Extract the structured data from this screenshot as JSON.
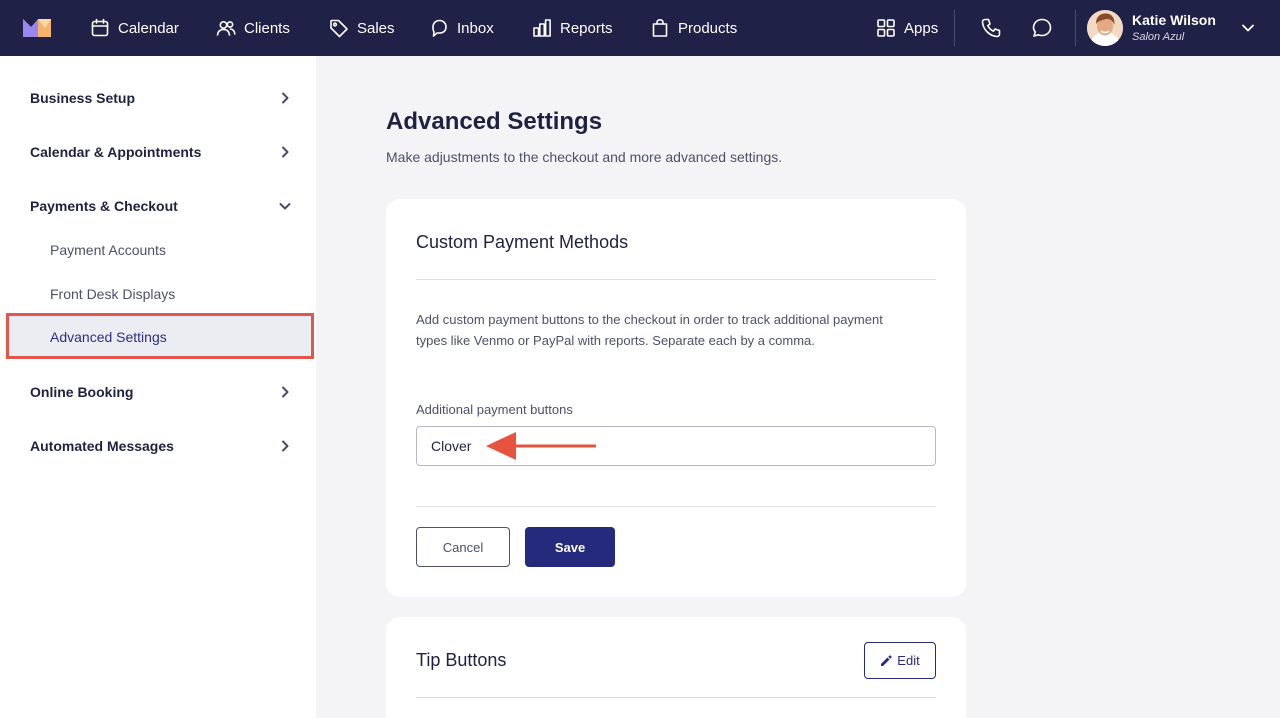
{
  "nav": {
    "items": [
      {
        "label": "Calendar",
        "icon": "calendar-icon"
      },
      {
        "label": "Clients",
        "icon": "users-icon"
      },
      {
        "label": "Sales",
        "icon": "tag-icon"
      },
      {
        "label": "Inbox",
        "icon": "inbox-icon"
      },
      {
        "label": "Reports",
        "icon": "bar-chart-icon"
      },
      {
        "label": "Products",
        "icon": "shopping-bag-icon"
      }
    ],
    "apps_label": "Apps",
    "user": {
      "name": "Katie Wilson",
      "business": "Salon Azul"
    }
  },
  "sidebar": {
    "sections": [
      {
        "label": "Business Setup",
        "expanded": false
      },
      {
        "label": "Calendar & Appointments",
        "expanded": false
      },
      {
        "label": "Payments & Checkout",
        "expanded": true
      },
      {
        "label": "Online Booking",
        "expanded": false
      },
      {
        "label": "Automated Messages",
        "expanded": false
      }
    ],
    "sub_items": [
      "Payment Accounts",
      "Front Desk Displays",
      "Advanced Settings"
    ],
    "active_sub_item": "Advanced Settings"
  },
  "main": {
    "title": "Advanced Settings",
    "subtitle": "Make adjustments to the checkout and more advanced settings.",
    "custom_payment": {
      "title": "Custom Payment Methods",
      "description": "Add custom payment buttons to the checkout in order to track additional payment types like Venmo or PayPal with reports. Separate each by a comma.",
      "field_label": "Additional payment buttons",
      "field_value": "Clover",
      "cancel_label": "Cancel",
      "save_label": "Save"
    },
    "tip_buttons": {
      "title": "Tip Buttons",
      "edit_label": "Edit"
    }
  },
  "colors": {
    "topbar": "#1f2147",
    "primary": "#262a7d",
    "highlight": "#e2574c",
    "annotation_arrow": "#e8533f"
  }
}
